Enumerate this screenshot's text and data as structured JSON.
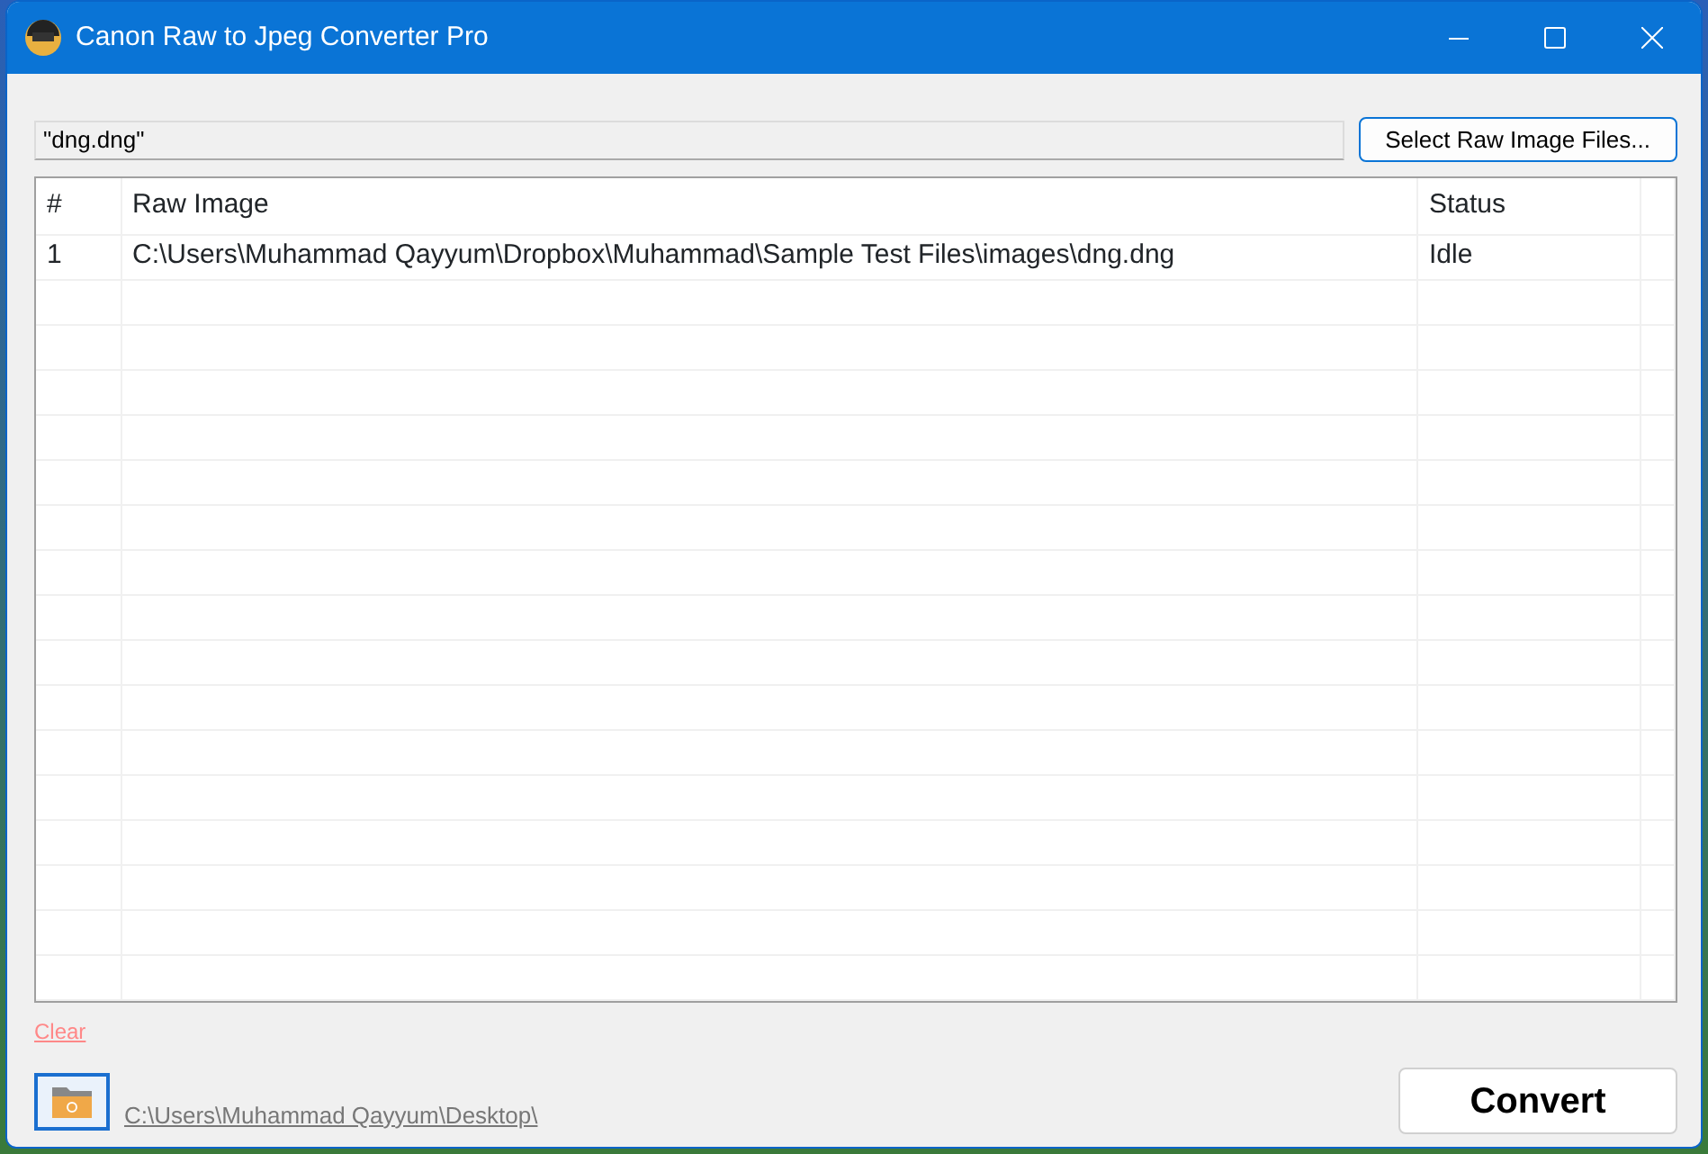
{
  "window": {
    "title": "Canon Raw to Jpeg Converter Pro"
  },
  "file_field": {
    "value": "\"dng.dng\""
  },
  "select_button": "Select Raw Image Files...",
  "table": {
    "columns": [
      "#",
      "Raw Image",
      "Status"
    ],
    "rows": [
      {
        "cells": [
          "1",
          "C:\\Users\\Muhammad Qayyum\\Dropbox\\Muhammad\\Sample Test Files\\images\\dng.dng",
          "Idle"
        ]
      }
    ]
  },
  "clear_link": "Clear",
  "output_folder": "C:\\Users\\Muhammad Qayyum\\Desktop\\",
  "convert_button": "Convert"
}
